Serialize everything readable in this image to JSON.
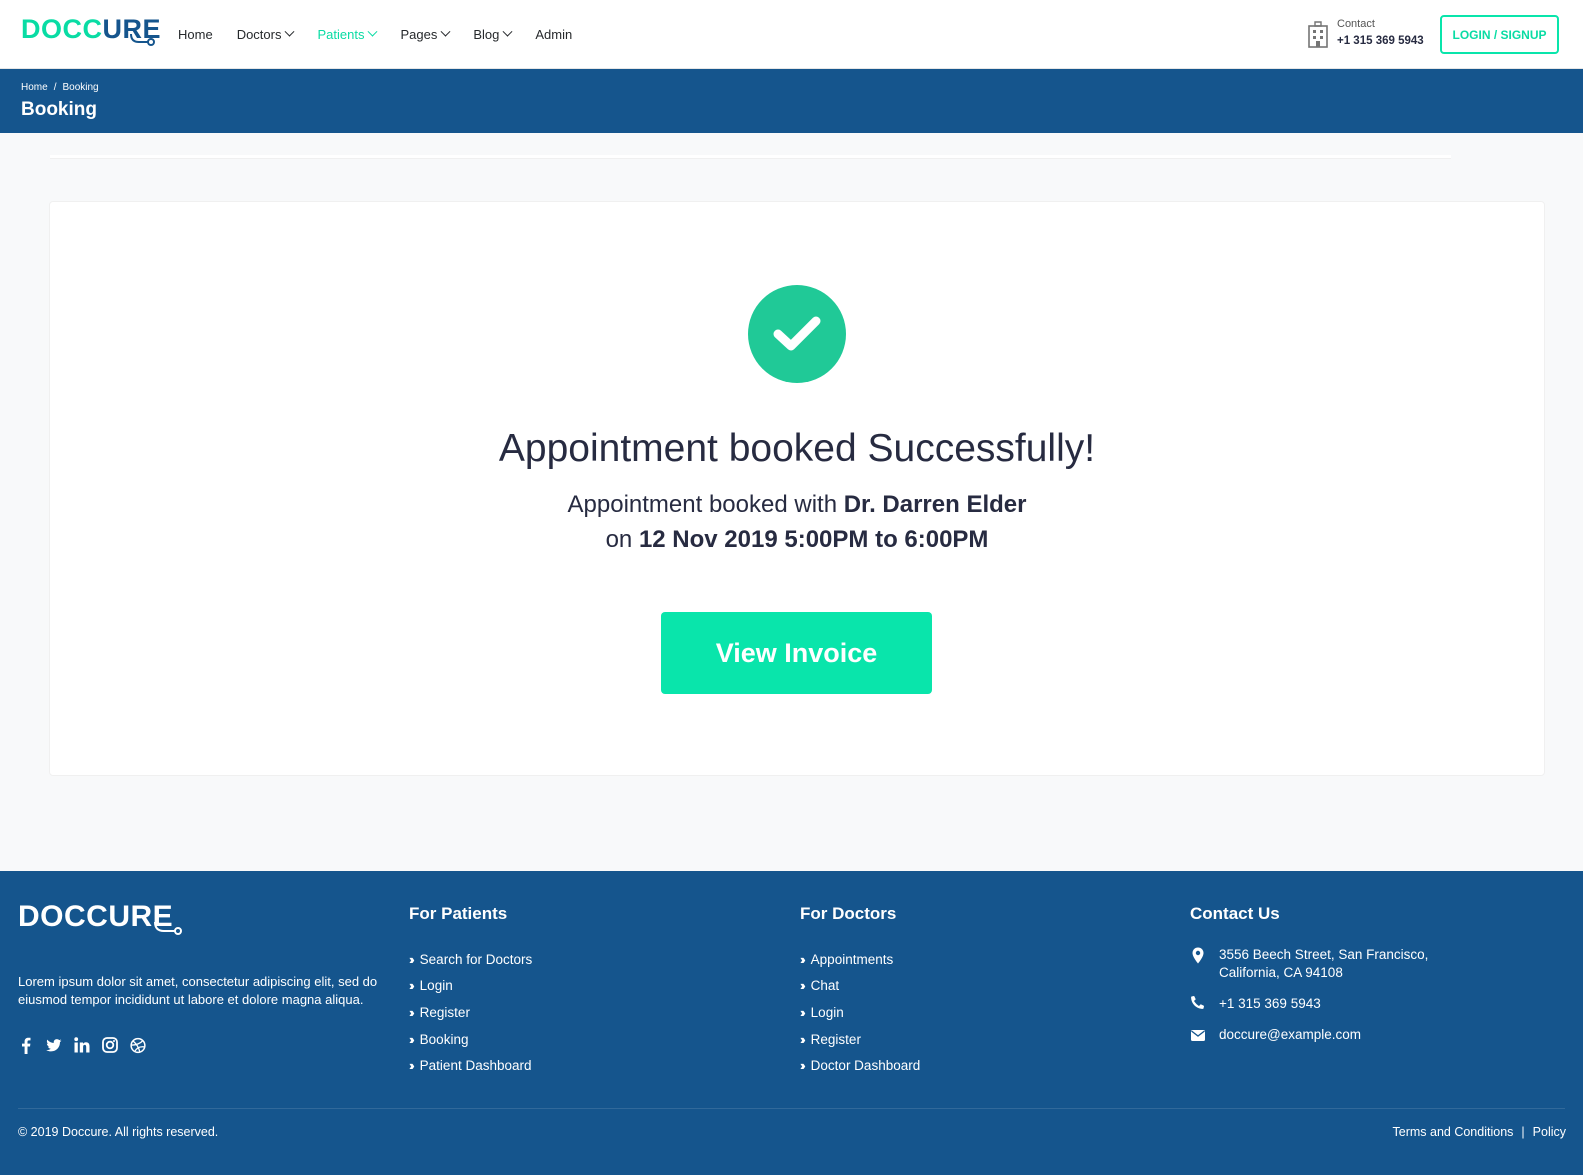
{
  "brand": {
    "logo_part1": "DOCC",
    "logo_part2": "URE",
    "primary_color": "#15558d",
    "accent_color": "#09dca4"
  },
  "header": {
    "nav": [
      {
        "label": "Home",
        "dropdown": false,
        "active": false
      },
      {
        "label": "Doctors",
        "dropdown": true,
        "active": false
      },
      {
        "label": "Patients",
        "dropdown": true,
        "active": true
      },
      {
        "label": "Pages",
        "dropdown": true,
        "active": false
      },
      {
        "label": "Blog",
        "dropdown": true,
        "active": false
      },
      {
        "label": "Admin",
        "dropdown": false,
        "active": false
      }
    ],
    "contact_label": "Contact",
    "contact_phone": "+1 315 369 5943",
    "contact_icon": "hospital-building-icon",
    "login_label": "LOGIN / SIGNUP"
  },
  "breadcrumb": {
    "items": [
      "Home",
      "Booking"
    ],
    "separator": "/",
    "title": "Booking"
  },
  "success": {
    "icon": "check-circle-icon",
    "title": "Appointment booked Successfully!",
    "line1_prefix": "Appointment booked with ",
    "doctor": "Dr. Darren Elder",
    "line2_prefix": "on ",
    "datetime": "12 Nov 2019 5:00PM to 6:00PM",
    "button_label": "View Invoice"
  },
  "footer": {
    "about": "Lorem ipsum dolor sit amet, consectetur adipiscing elit, sed do eiusmod tempor incididunt ut labore et dolore magna aliqua.",
    "social": [
      "facebook-icon",
      "twitter-icon",
      "linkedin-icon",
      "instagram-icon",
      "dribbble-icon"
    ],
    "patients": {
      "title": "For Patients",
      "links": [
        "Search for Doctors",
        "Login",
        "Register",
        "Booking",
        "Patient Dashboard"
      ]
    },
    "doctors": {
      "title": "For Doctors",
      "links": [
        "Appointments",
        "Chat",
        "Login",
        "Register",
        "Doctor Dashboard"
      ]
    },
    "contact": {
      "title": "Contact Us",
      "address_line1": "3556 Beech Street, San Francisco,",
      "address_line2": "California, CA 94108",
      "phone": "+1 315 369 5943",
      "email": "doccure@example.com"
    },
    "copyright": "© 2019 Doccure. All rights reserved.",
    "terms": "Terms and Conditions",
    "policy_sep": "|",
    "policy": "Policy"
  }
}
